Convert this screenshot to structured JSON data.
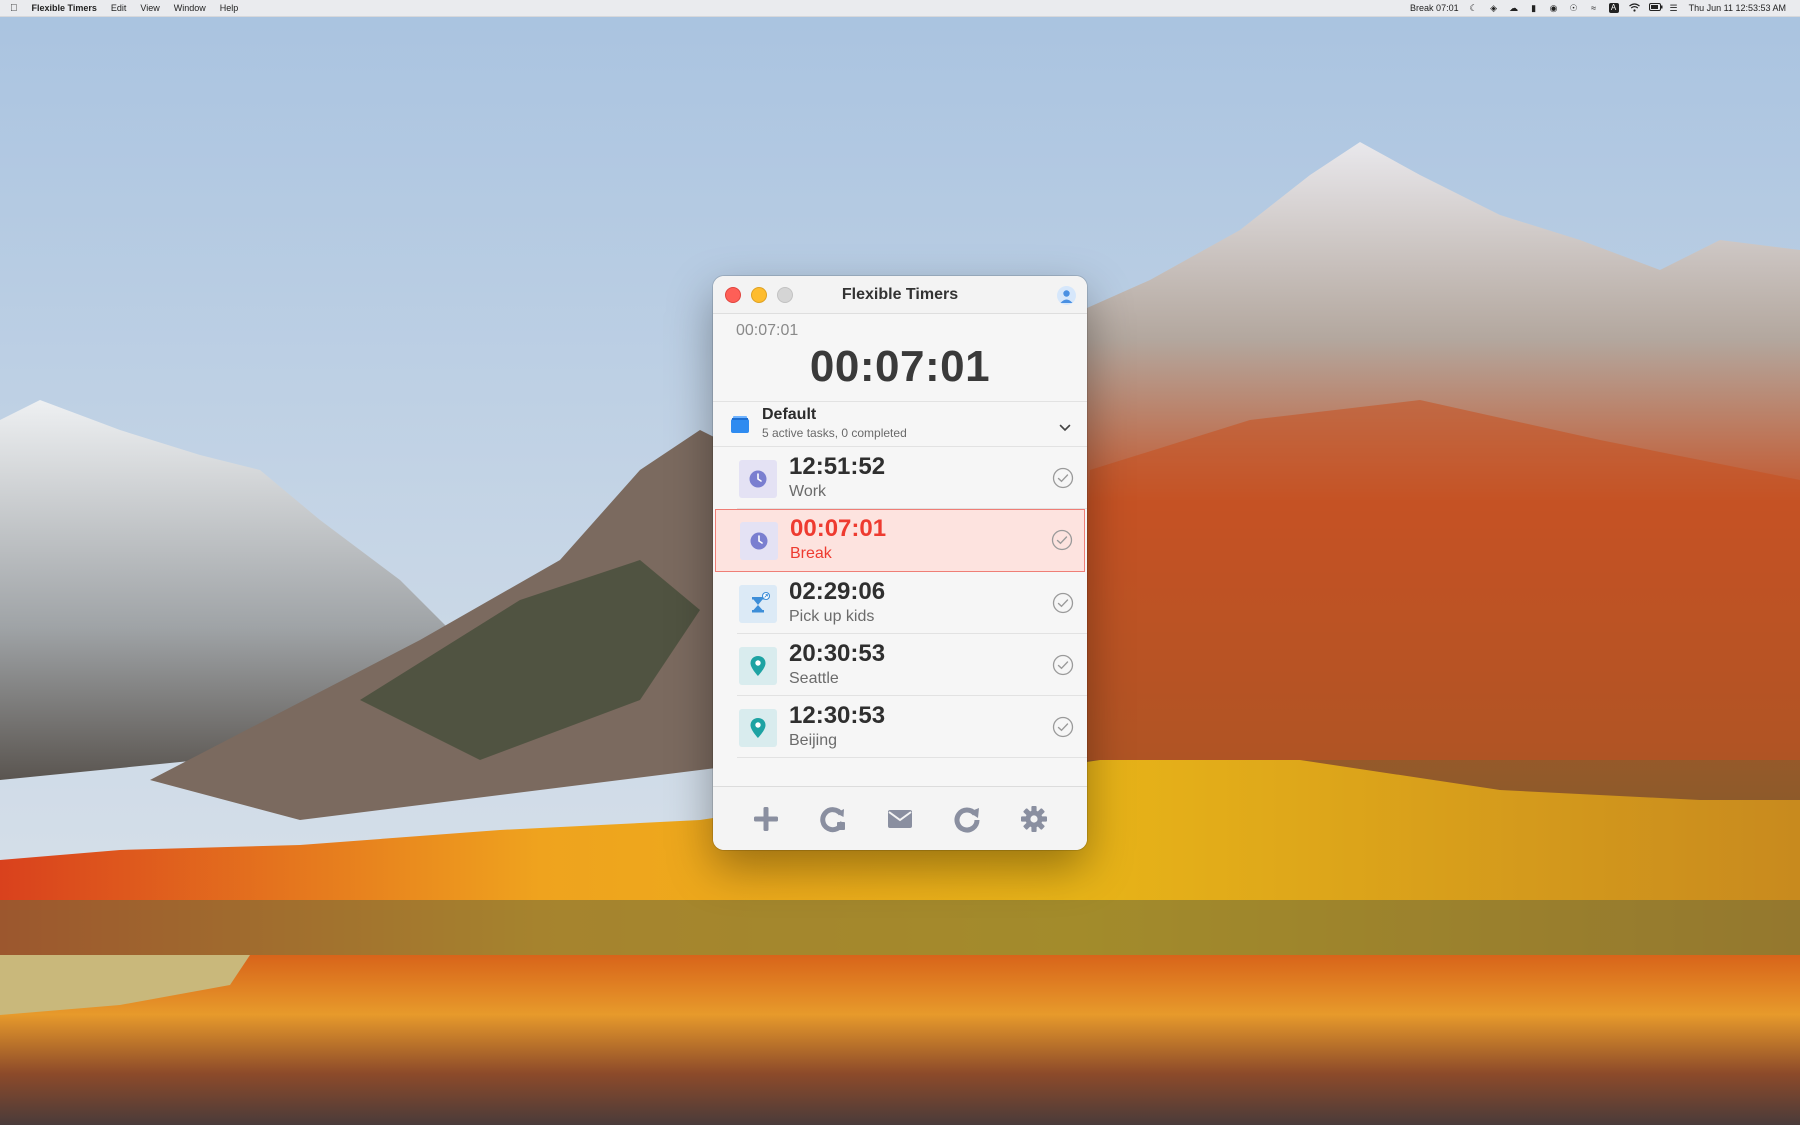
{
  "menubar": {
    "app_name": "Flexible Timers",
    "menus": [
      "Edit",
      "View",
      "Window",
      "Help"
    ],
    "status_item": "Break 07:01",
    "datetime": "Thu Jun 11  12:53:53 AM"
  },
  "window": {
    "title": "Flexible Timers",
    "current": {
      "small_time": "00:07:01",
      "big_time": "00:07:01"
    },
    "list": {
      "title": "Default",
      "subtitle": "5 active tasks, 0 completed"
    },
    "timers": [
      {
        "time": "12:51:52",
        "label": "Work",
        "icon": "clock-icon",
        "active": false
      },
      {
        "time": "00:07:01",
        "label": "Break",
        "icon": "clock-icon",
        "active": true
      },
      {
        "time": "02:29:06",
        "label": "Pick up kids",
        "icon": "hourglass-icon",
        "active": false
      },
      {
        "time": "20:30:53",
        "label": "Seattle",
        "icon": "location-pin-icon",
        "active": false
      },
      {
        "time": "12:30:53",
        "label": "Beijing",
        "icon": "location-pin-icon",
        "active": false
      }
    ],
    "toolbar": [
      "add-icon",
      "reset-icon",
      "mail-icon",
      "refresh-icon",
      "gear-icon"
    ]
  },
  "colors": {
    "accent": "#7a7fd0",
    "active_text": "#ee3b30",
    "active_bg": "#fde3df",
    "toolbar_icon": "#8a8fa0"
  }
}
